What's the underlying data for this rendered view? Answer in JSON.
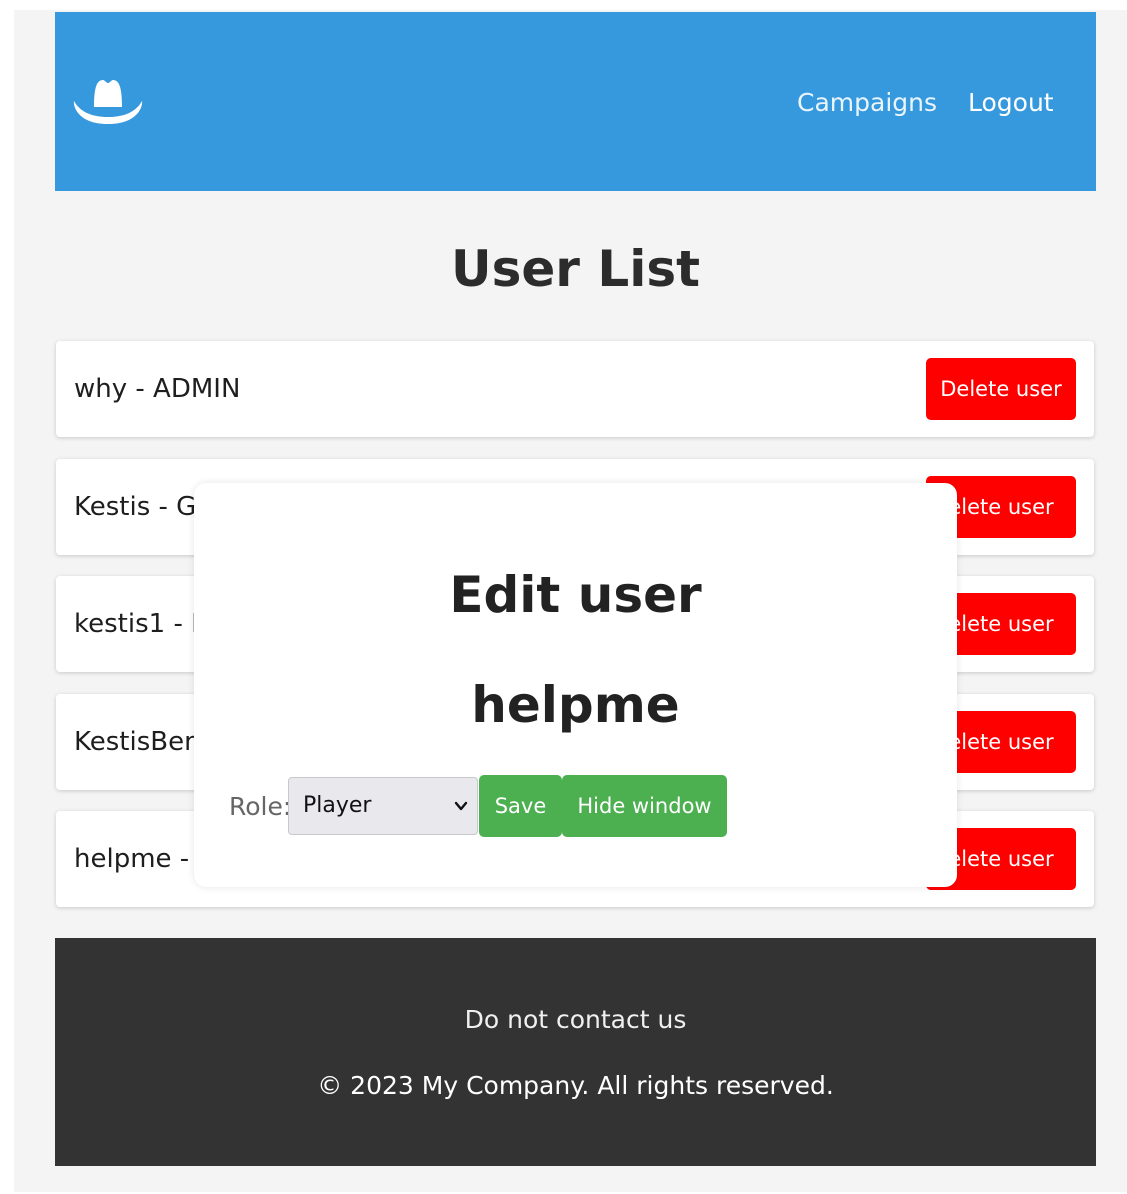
{
  "header": {
    "logo_icon": "cowboy-hat-icon",
    "nav": {
      "campaigns": "Campaigns",
      "logout": "Logout"
    },
    "background_color": "#3799dd"
  },
  "main": {
    "title": "User List",
    "users": [
      {
        "label": "why - ADMIN",
        "delete_label": "Delete user"
      },
      {
        "label": "Kestis - GA",
        "delete_label": "elete user"
      },
      {
        "label": "kestis1 - P",
        "delete_label": "elete user"
      },
      {
        "label": "KestisBena",
        "delete_label": "elete user"
      },
      {
        "label": "helpme -",
        "delete_label": "elete user"
      }
    ],
    "delete_color": "#ff0000"
  },
  "modal": {
    "title": "Edit user",
    "username": "helpme",
    "role_label": "Role:",
    "role_value": "Player",
    "save_label": "Save",
    "hide_label": "Hide window",
    "button_color": "#4caf50"
  },
  "footer": {
    "contact": "Do not contact us",
    "copyright": "© 2023 My Company. All rights reserved.",
    "background_color": "#333333"
  }
}
